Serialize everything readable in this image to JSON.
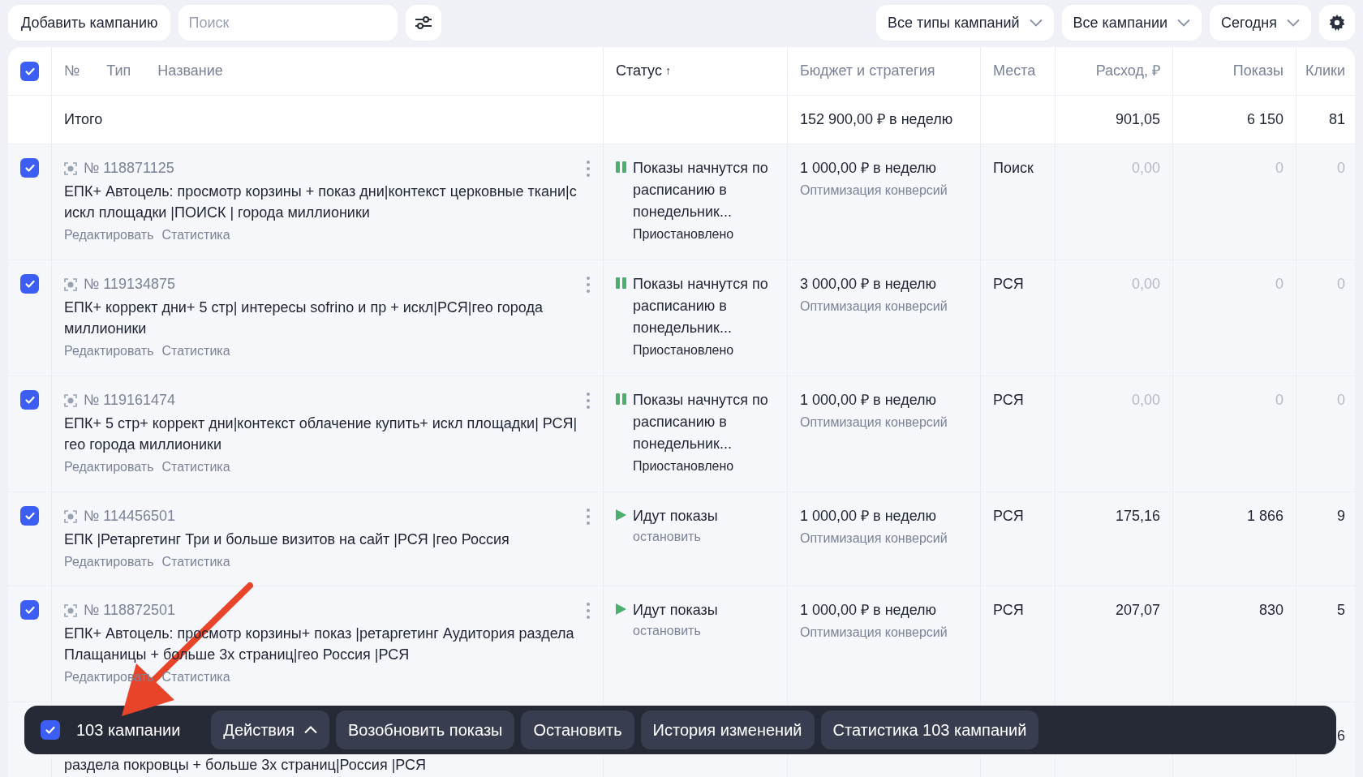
{
  "toolbar": {
    "add_button": "Добавить кампанию",
    "search": {
      "placeholder": "Поиск"
    },
    "filters": [
      "Все типы кампаний",
      "Все кампании",
      "Сегодня"
    ]
  },
  "table": {
    "all_checked": true,
    "columns": {
      "number": "№",
      "type": "Тип",
      "name": "Название",
      "status": "Статус",
      "status_sort": "↑",
      "budget": "Бюджет и стратегия",
      "places": "Места",
      "spend": "Расход, ₽",
      "impressions": "Показы",
      "clicks": "Клики"
    },
    "total": {
      "label": "Итого",
      "budget": "152 900,00 ₽ в неделю",
      "spend": "901,05",
      "impressions": "6 150",
      "clicks": "81"
    },
    "rows": [
      {
        "checked": true,
        "number": "№ 118871125",
        "name": "ЕПК+ Автоцель: просмотр корзины + показ дни|контекст церковные ткани|с искл площадки |ПОИСК | города миллионики",
        "links": [
          "Редактировать",
          "Статистика"
        ],
        "kind": "paused",
        "status": "Показы начнутся по расписанию в понедельник...",
        "status_note": "Приостановлено",
        "budget": "1 000,00 ₽ в неделю",
        "strategy": "Оптимизация конверсий",
        "places": "Поиск",
        "spend": "0,00",
        "impressions": "0",
        "clicks": "0",
        "zero": true
      },
      {
        "checked": true,
        "number": "№ 119134875",
        "name": "ЕПК+ коррект дни+ 5 стр| интересы sofrino и пр + искл|РСЯ|гео города миллионики",
        "links": [
          "Редактировать",
          "Статистика"
        ],
        "kind": "paused",
        "status": "Показы начнутся по расписанию в понедельник...",
        "status_note": "Приостановлено",
        "budget": "3 000,00 ₽ в неделю",
        "strategy": "Оптимизация конверсий",
        "places": "РСЯ",
        "spend": "0,00",
        "impressions": "0",
        "clicks": "0",
        "zero": true
      },
      {
        "checked": true,
        "number": "№ 119161474",
        "name": "ЕПК+ 5 стр+ коррект дни|контекст облачение купить+ искл площадки| РСЯ| гео города миллионики",
        "links": [
          "Редактировать",
          "Статистика"
        ],
        "kind": "paused",
        "status": "Показы начнутся по расписанию в понедельник...",
        "status_note": "Приостановлено",
        "budget": "1 000,00 ₽ в неделю",
        "strategy": "Оптимизация конверсий",
        "places": "РСЯ",
        "spend": "0,00",
        "impressions": "0",
        "clicks": "0",
        "zero": true
      },
      {
        "checked": true,
        "number": "№ 114456501",
        "name": "ЕПК |Ретаргетинг Три и больше визитов на сайт |РСЯ |гео Россия",
        "links": [
          "Редактировать",
          "Статистика"
        ],
        "kind": "running",
        "status": "Идут показы",
        "status_link": "остановить",
        "budget": "1 000,00 ₽ в неделю",
        "strategy": "Оптимизация конверсий",
        "places": "РСЯ",
        "spend": "175,16",
        "impressions": "1 866",
        "clicks": "9",
        "zero": false
      },
      {
        "checked": true,
        "number": "№ 118872501",
        "name": "ЕПК+ Автоцель: просмотр корзины+ показ |ретаргетинг Аудитория раздела Плащаницы + больше 3х страниц|гео Россия |РСЯ",
        "links": [
          "Редактировать",
          "Статистика"
        ],
        "kind": "running",
        "status": "Идут показы",
        "status_link": "остановить",
        "budget": "1 000,00 ₽ в неделю",
        "strategy": "Оптимизация конверсий",
        "places": "РСЯ",
        "spend": "207,07",
        "impressions": "830",
        "clicks": "5",
        "zero": false
      }
    ],
    "partial_row": {
      "name": "раздела покровцы + больше 3х страниц|Россия |РСЯ",
      "clicks": "6"
    }
  },
  "action_bar": {
    "checked": true,
    "count": "103 кампании",
    "actions": [
      "Действия",
      "Возобновить показы",
      "Остановить",
      "История изменений",
      "Статистика 103 кампаний"
    ]
  }
}
